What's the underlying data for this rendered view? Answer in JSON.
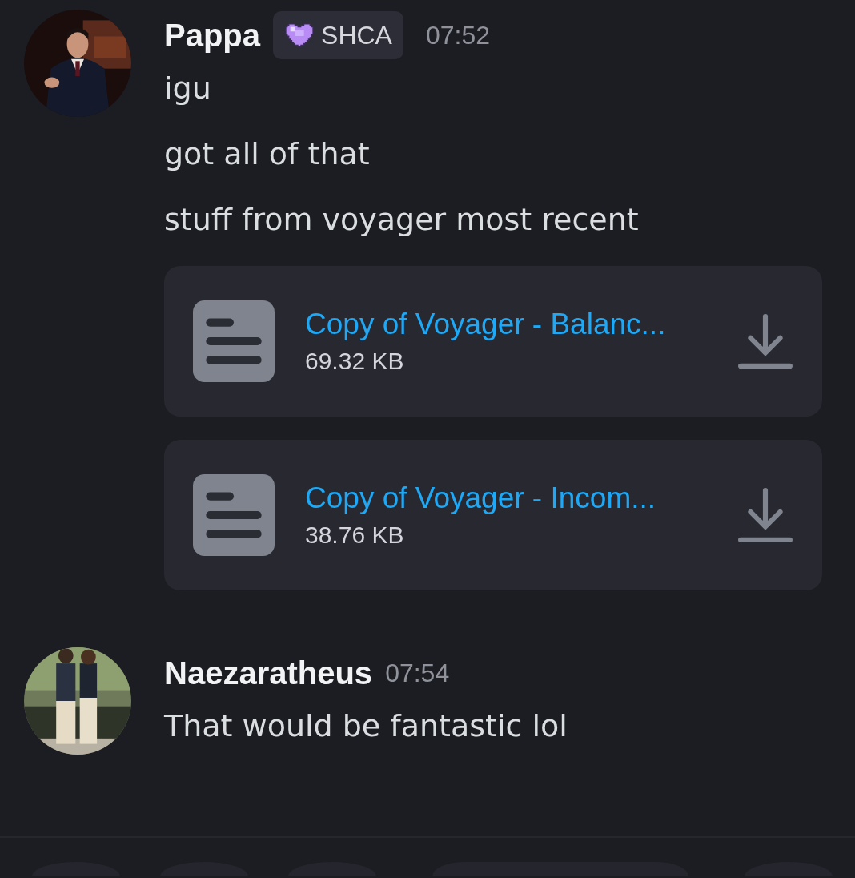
{
  "messages": [
    {
      "author": "Pappa",
      "badge": {
        "label": "SHCA"
      },
      "time": "07:52",
      "lines": [
        "igu",
        "got all of that",
        "stuff from voyager most recent"
      ],
      "attachments": [
        {
          "name": "Copy of Voyager - Balanc...",
          "size": "69.32 KB"
        },
        {
          "name": "Copy of Voyager - Incom...",
          "size": "38.76 KB"
        }
      ],
      "avatar": {
        "kind": "picture"
      }
    },
    {
      "author": "Naezaratheus",
      "time": "07:54",
      "lines": [
        "That would be fantastic lol"
      ],
      "avatar": {
        "kind": "picture"
      }
    }
  ],
  "bottom_bar": {
    "buttons": [
      {
        "kind": "round"
      },
      {
        "kind": "round"
      },
      {
        "kind": "round"
      },
      {
        "kind": "pill"
      },
      {
        "kind": "round"
      }
    ]
  }
}
